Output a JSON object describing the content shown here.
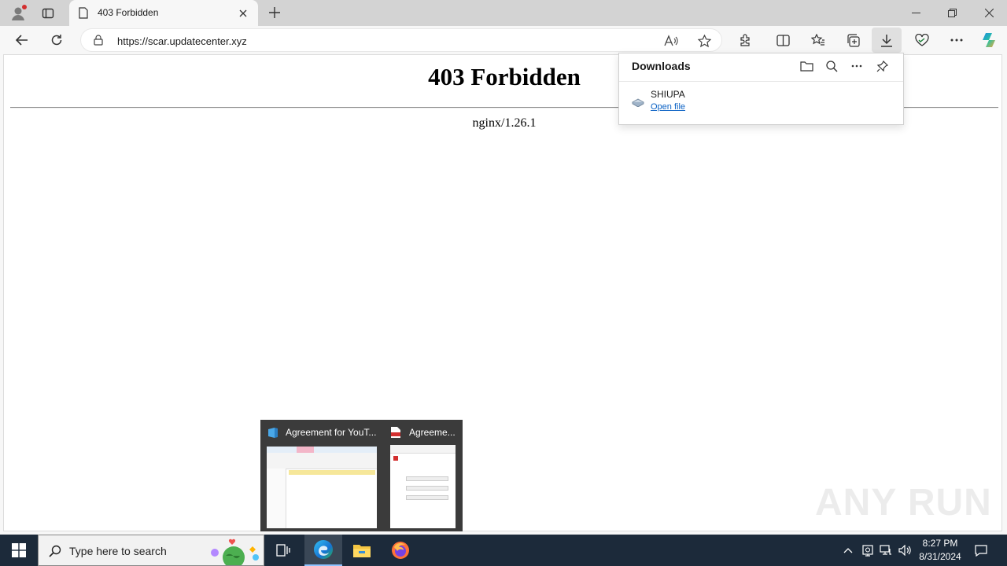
{
  "browser": {
    "tab": {
      "title": "403 Forbidden"
    },
    "address_bar": {
      "url": "https://scar.updatecenter.xyz"
    }
  },
  "page": {
    "heading": "403 Forbidden",
    "server": "nginx/1.26.1"
  },
  "downloads_panel": {
    "title": "Downloads",
    "items": [
      {
        "name": "SHIUPA",
        "action": "Open file"
      }
    ]
  },
  "taskbar_preview": {
    "windows": [
      {
        "title": "Agreement for YouT..."
      },
      {
        "title": "Agreeme..."
      }
    ]
  },
  "watermark": "ANY RUN",
  "taskbar": {
    "search_placeholder": "Type here to search",
    "time": "8:27 PM",
    "date": "8/31/2024"
  },
  "colors": {
    "accent": "#0b62c4",
    "taskbar": "#1c2a3a"
  }
}
